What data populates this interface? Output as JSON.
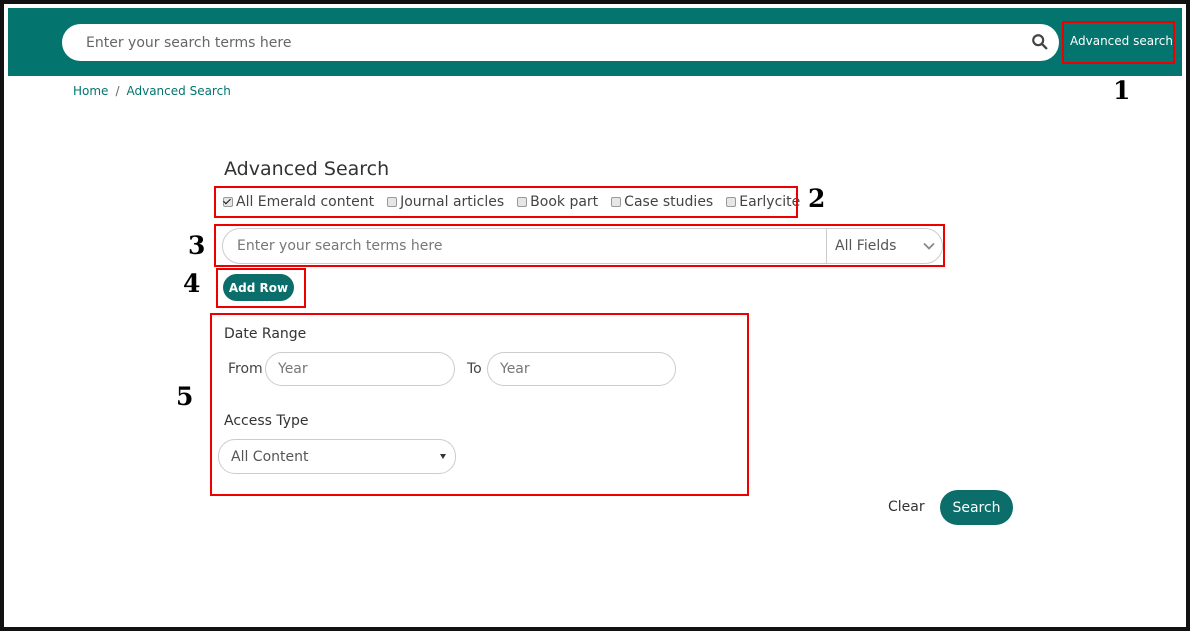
{
  "header": {
    "search_placeholder": "Enter your search terms here",
    "advanced_search_link": "Advanced search",
    "search_icon": "search-icon",
    "background_color": "#04746f"
  },
  "breadcrumb": {
    "home": "Home",
    "separator": "/",
    "current": "Advanced Search"
  },
  "markers": {
    "m1": "1",
    "m2": "2",
    "m3": "3",
    "m4": "4",
    "m5": "5",
    "color": "#ee0000"
  },
  "main": {
    "title": "Advanced Search",
    "content_filters": [
      {
        "label": "All Emerald content",
        "checked": true
      },
      {
        "label": "Journal articles",
        "checked": false
      },
      {
        "label": "Book part",
        "checked": false
      },
      {
        "label": "Case studies",
        "checked": false
      },
      {
        "label": "Earlycite",
        "checked": false
      }
    ],
    "search_row": {
      "placeholder": "Enter your search terms here",
      "field_select": "All Fields"
    },
    "add_row_label": "Add Row",
    "date_range": {
      "label": "Date Range",
      "from_label": "From",
      "from_placeholder": "Year",
      "to_label": "To",
      "to_placeholder": "Year"
    },
    "access_type": {
      "label": "Access Type",
      "selected": "All Content"
    },
    "clear_label": "Clear",
    "search_label": "Search",
    "accent_color": "#0b6e6a"
  }
}
